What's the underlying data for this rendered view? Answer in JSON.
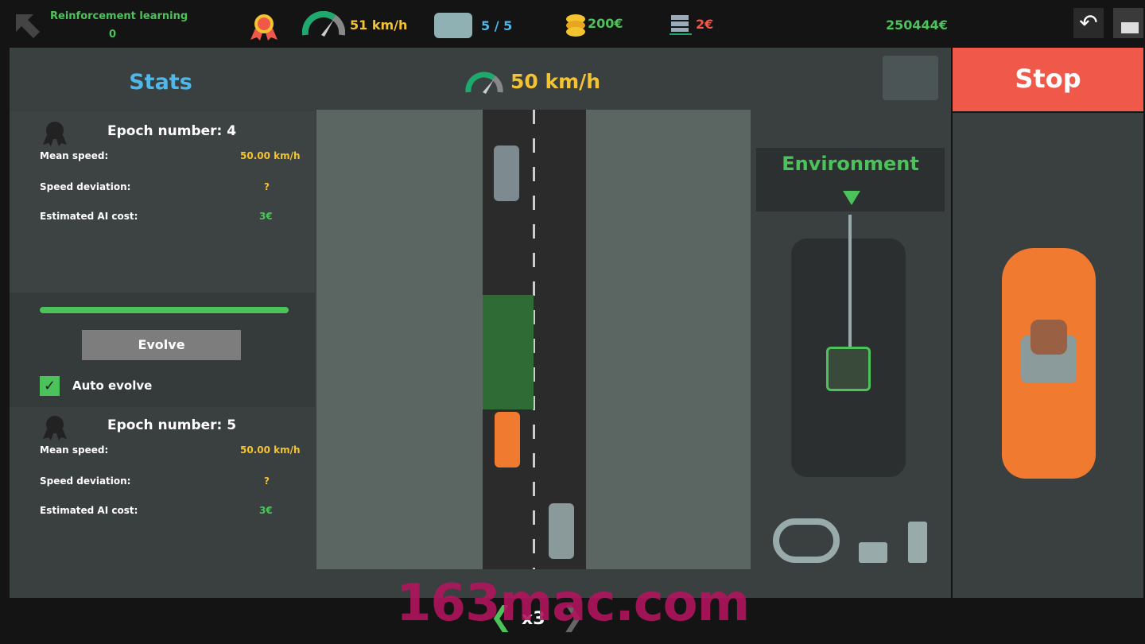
{
  "topbar": {
    "mode_title": "Reinforcement learning",
    "mode_value": "0",
    "speed": "51 km/h",
    "cars": "5 / 5",
    "coins": "200€",
    "server_cost": "2€",
    "balance": "250444€",
    "icons": [
      "back-arrow-icon",
      "medal-icon",
      "speedometer-icon",
      "cat-icon",
      "coins-icon",
      "server-icon",
      "undo-icon",
      "broom-icon"
    ]
  },
  "header": {
    "stats_title": "Stats",
    "speed": "50 km/h",
    "stop_label": "Stop"
  },
  "epochs": [
    {
      "title": "Epoch number: 4",
      "mean_speed_label": "Mean speed:",
      "mean_speed": "50.00 km/h",
      "deviation_label": "Speed deviation:",
      "deviation": "?",
      "cost_label": "Estimated AI cost:",
      "cost": "3€"
    },
    {
      "title": "Epoch number: 5",
      "mean_speed_label": "Mean speed:",
      "mean_speed": "50.00 km/h",
      "deviation_label": "Speed deviation:",
      "deviation": "?",
      "cost_label": "Estimated AI cost:",
      "cost": "3€"
    }
  ],
  "training": {
    "progress": 1.0,
    "evolve_label": "Evolve",
    "auto_evolve_label": "Auto evolve",
    "auto_evolve_checked": true
  },
  "environment": {
    "title": "Environment"
  },
  "bottom": {
    "speed_multiplier": "x3"
  },
  "watermark": "163mac.com",
  "colors": {
    "green": "#4cc25a",
    "yellow": "#f4c330",
    "blue": "#4fb8e8",
    "red": "#f0584a",
    "stop": "#f0584a"
  }
}
